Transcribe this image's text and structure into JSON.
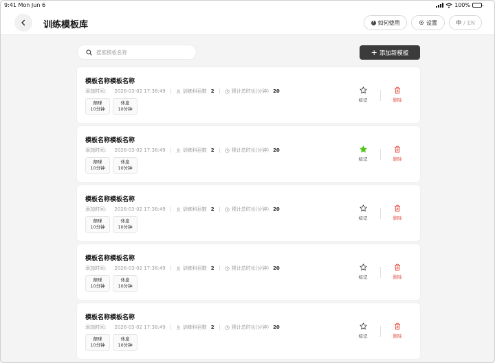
{
  "status_bar": {
    "time": "9:41 Mon Jun 6",
    "battery": "100%"
  },
  "header": {
    "title": "训练模板库",
    "help_label": "如何使用",
    "settings_label": "设置",
    "lang_cn": "中",
    "lang_sep": " / ",
    "lang_en": "EN"
  },
  "search": {
    "placeholder": "搜索模板名称",
    "value": ""
  },
  "add_button_label": "添加新模板",
  "colors": {
    "accent_dark": "#3b3b3b",
    "star_active": "#52c41a",
    "delete_red": "#e4584b"
  },
  "templates": [
    {
      "name": "模板名称模板名称",
      "time_label": "添加时间:",
      "time_value": "2026-03-02 17:38:49",
      "subjects_label": "训练科目数",
      "subjects_count": "2",
      "duration_label": "预计总时长(分钟)",
      "duration_value": "20",
      "tags": [
        {
          "name": "颠球",
          "duration": "10分钟"
        },
        {
          "name": "休息",
          "duration": "10分钟"
        }
      ],
      "mark_label": "标记",
      "marked": false,
      "delete_label": "删除"
    },
    {
      "name": "模板名称模板名称",
      "time_label": "添加时间:",
      "time_value": "2026-03-02 17:38:49",
      "subjects_label": "训练科目数",
      "subjects_count": "2",
      "duration_label": "预计总时长(分钟)",
      "duration_value": "20",
      "tags": [
        {
          "name": "颠球",
          "duration": "10分钟"
        },
        {
          "name": "休息",
          "duration": "10分钟"
        }
      ],
      "mark_label": "标记",
      "marked": true,
      "delete_label": "删除"
    },
    {
      "name": "模板名称模板名称",
      "time_label": "添加时间:",
      "time_value": "2026-03-02 17:38:49",
      "subjects_label": "训练科目数",
      "subjects_count": "2",
      "duration_label": "预计总时长(分钟)",
      "duration_value": "20",
      "tags": [
        {
          "name": "颠球",
          "duration": "10分钟"
        },
        {
          "name": "休息",
          "duration": "10分钟"
        }
      ],
      "mark_label": "标记",
      "marked": false,
      "delete_label": "删除"
    },
    {
      "name": "模板名称模板名称",
      "time_label": "添加时间:",
      "time_value": "2026-03-02 17:38:49",
      "subjects_label": "训练科目数",
      "subjects_count": "2",
      "duration_label": "预计总时长(分钟)",
      "duration_value": "20",
      "tags": [
        {
          "name": "颠球",
          "duration": "10分钟"
        },
        {
          "name": "休息",
          "duration": "10分钟"
        }
      ],
      "mark_label": "标记",
      "marked": false,
      "delete_label": "删除"
    },
    {
      "name": "模板名称模板名称",
      "time_label": "添加时间:",
      "time_value": "2026-03-02 17:38:49",
      "subjects_label": "训练科目数",
      "subjects_count": "2",
      "duration_label": "预计总时长(分钟)",
      "duration_value": "20",
      "tags": [
        {
          "name": "颠球",
          "duration": "10分钟"
        },
        {
          "name": "休息",
          "duration": "10分钟"
        }
      ],
      "mark_label": "标记",
      "marked": false,
      "delete_label": "删除"
    }
  ]
}
